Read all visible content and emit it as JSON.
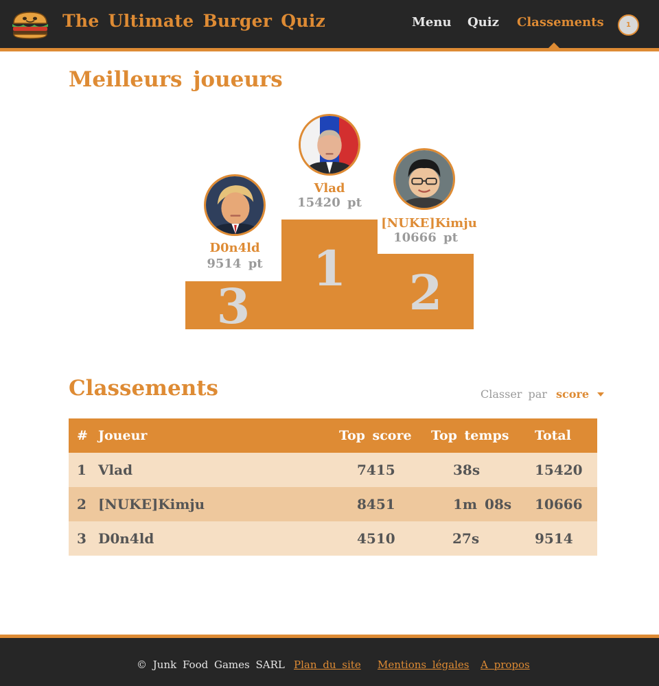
{
  "header": {
    "brand": "The Ultimate Burger Quiz",
    "nav": [
      "Menu",
      "Quiz",
      "Classements"
    ],
    "active_nav": "Classements",
    "user_badge": "1"
  },
  "podium": {
    "title": "Meilleurs joueurs",
    "places": [
      {
        "rank": "1",
        "name": "Vlad",
        "score": "15420 pt"
      },
      {
        "rank": "2",
        "name": "[NUKE]Kimju",
        "score": "10666 pt"
      },
      {
        "rank": "3",
        "name": "D0n4ld",
        "score": "9514 pt"
      }
    ]
  },
  "rankings": {
    "title": "Classements",
    "sort_label": "Classer par",
    "sort_value": "score",
    "columns": [
      "#",
      "Joueur",
      "Top score",
      "Top temps",
      "Total"
    ],
    "rows": [
      {
        "rank": "1",
        "player": "Vlad",
        "top_score": "7415",
        "top_time": "38s",
        "total": "15420"
      },
      {
        "rank": "2",
        "player": "[NUKE]Kimju",
        "top_score": "8451",
        "top_time": "1m 08s",
        "total": "10666"
      },
      {
        "rank": "3",
        "player": "D0n4ld",
        "top_score": "4510",
        "top_time": "27s",
        "total": "9514"
      }
    ]
  },
  "footer": {
    "copyright": "© Junk Food Games SARL",
    "links": [
      "Plan du site",
      "Mentions légales",
      "A propos"
    ]
  },
  "colors": {
    "accent": "#de8b34",
    "dark": "#262626",
    "row_light": "#f6dfc4",
    "row_dark": "#eec89d"
  }
}
